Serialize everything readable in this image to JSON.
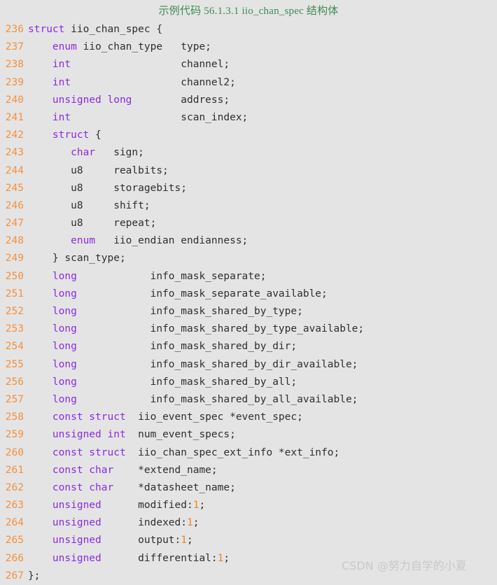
{
  "caption": "示例代码 56.1.3.1 iio_chan_spec 结构体",
  "watermark": "CSDN @努力自学的小夏",
  "colors": {
    "background": "#e4e4e4",
    "caption": "#3e8c53",
    "line_number": "#f6903d",
    "keyword": "#8a2be2",
    "number_literal": "#f4821f",
    "plain_text": "#2f2f2f",
    "watermark": "#c9c9c9"
  },
  "code": {
    "language": "c",
    "first_line_number": 236,
    "last_line_number": 267,
    "lines": [
      {
        "number": "236",
        "text": "struct iio_chan_spec {",
        "tokens": [
          {
            "t": "struct",
            "k": "kw"
          },
          {
            "t": " iio_chan_spec {",
            "k": "pln"
          }
        ]
      },
      {
        "number": "237",
        "text": "    enum iio_chan_type   type;",
        "tokens": [
          {
            "t": "    ",
            "k": "pln"
          },
          {
            "t": "enum",
            "k": "kw"
          },
          {
            "t": " iio_chan_type   type;",
            "k": "pln"
          }
        ]
      },
      {
        "number": "238",
        "text": "    int                  channel;",
        "tokens": [
          {
            "t": "    ",
            "k": "pln"
          },
          {
            "t": "int",
            "k": "kw"
          },
          {
            "t": "                  channel;",
            "k": "pln"
          }
        ]
      },
      {
        "number": "239",
        "text": "    int                  channel2;",
        "tokens": [
          {
            "t": "    ",
            "k": "pln"
          },
          {
            "t": "int",
            "k": "kw"
          },
          {
            "t": "                  channel2;",
            "k": "pln"
          }
        ]
      },
      {
        "number": "240",
        "text": "    unsigned long        address;",
        "tokens": [
          {
            "t": "    ",
            "k": "pln"
          },
          {
            "t": "unsigned long",
            "k": "kw"
          },
          {
            "t": "        address;",
            "k": "pln"
          }
        ]
      },
      {
        "number": "241",
        "text": "    int                  scan_index;",
        "tokens": [
          {
            "t": "    ",
            "k": "pln"
          },
          {
            "t": "int",
            "k": "kw"
          },
          {
            "t": "                  scan_index;",
            "k": "pln"
          }
        ]
      },
      {
        "number": "242",
        "text": "    struct {",
        "tokens": [
          {
            "t": "    ",
            "k": "pln"
          },
          {
            "t": "struct",
            "k": "kw"
          },
          {
            "t": " {",
            "k": "pln"
          }
        ]
      },
      {
        "number": "243",
        "text": "       char   sign;",
        "tokens": [
          {
            "t": "       ",
            "k": "pln"
          },
          {
            "t": "char",
            "k": "kw"
          },
          {
            "t": "   sign;",
            "k": "pln"
          }
        ]
      },
      {
        "number": "244",
        "text": "       u8     realbits;",
        "tokens": [
          {
            "t": "       u8     realbits;",
            "k": "pln"
          }
        ]
      },
      {
        "number": "245",
        "text": "       u8     storagebits;",
        "tokens": [
          {
            "t": "       u8     storagebits;",
            "k": "pln"
          }
        ]
      },
      {
        "number": "246",
        "text": "       u8     shift;",
        "tokens": [
          {
            "t": "       u8     shift;",
            "k": "pln"
          }
        ]
      },
      {
        "number": "247",
        "text": "       u8     repeat;",
        "tokens": [
          {
            "t": "       u8     repeat;",
            "k": "pln"
          }
        ]
      },
      {
        "number": "248",
        "text": "       enum   iio_endian endianness;",
        "tokens": [
          {
            "t": "       ",
            "k": "pln"
          },
          {
            "t": "enum",
            "k": "kw"
          },
          {
            "t": "   iio_endian endianness;",
            "k": "pln"
          }
        ]
      },
      {
        "number": "249",
        "text": "    } scan_type;",
        "tokens": [
          {
            "t": "    } scan_type;",
            "k": "pln"
          }
        ]
      },
      {
        "number": "250",
        "text": "    long            info_mask_separate;",
        "tokens": [
          {
            "t": "    ",
            "k": "pln"
          },
          {
            "t": "long",
            "k": "kw"
          },
          {
            "t": "            info_mask_separate;",
            "k": "pln"
          }
        ]
      },
      {
        "number": "251",
        "text": "    long            info_mask_separate_available;",
        "tokens": [
          {
            "t": "    ",
            "k": "pln"
          },
          {
            "t": "long",
            "k": "kw"
          },
          {
            "t": "            info_mask_separate_available;",
            "k": "pln"
          }
        ]
      },
      {
        "number": "252",
        "text": "    long            info_mask_shared_by_type;",
        "tokens": [
          {
            "t": "    ",
            "k": "pln"
          },
          {
            "t": "long",
            "k": "kw"
          },
          {
            "t": "            info_mask_shared_by_type;",
            "k": "pln"
          }
        ]
      },
      {
        "number": "253",
        "text": "    long            info_mask_shared_by_type_available;",
        "tokens": [
          {
            "t": "    ",
            "k": "pln"
          },
          {
            "t": "long",
            "k": "kw"
          },
          {
            "t": "            info_mask_shared_by_type_available;",
            "k": "pln"
          }
        ]
      },
      {
        "number": "254",
        "text": "    long            info_mask_shared_by_dir;",
        "tokens": [
          {
            "t": "    ",
            "k": "pln"
          },
          {
            "t": "long",
            "k": "kw"
          },
          {
            "t": "            info_mask_shared_by_dir;",
            "k": "pln"
          }
        ]
      },
      {
        "number": "255",
        "text": "    long            info_mask_shared_by_dir_available;",
        "tokens": [
          {
            "t": "    ",
            "k": "pln"
          },
          {
            "t": "long",
            "k": "kw"
          },
          {
            "t": "            info_mask_shared_by_dir_available;",
            "k": "pln"
          }
        ]
      },
      {
        "number": "256",
        "text": "    long            info_mask_shared_by_all;",
        "tokens": [
          {
            "t": "    ",
            "k": "pln"
          },
          {
            "t": "long",
            "k": "kw"
          },
          {
            "t": "            info_mask_shared_by_all;",
            "k": "pln"
          }
        ]
      },
      {
        "number": "257",
        "text": "    long            info_mask_shared_by_all_available;",
        "tokens": [
          {
            "t": "    ",
            "k": "pln"
          },
          {
            "t": "long",
            "k": "kw"
          },
          {
            "t": "            info_mask_shared_by_all_available;",
            "k": "pln"
          }
        ]
      },
      {
        "number": "258",
        "text": "    const struct  iio_event_spec *event_spec;",
        "tokens": [
          {
            "t": "    ",
            "k": "pln"
          },
          {
            "t": "const struct",
            "k": "kw"
          },
          {
            "t": "  iio_event_spec *event_spec;",
            "k": "pln"
          }
        ]
      },
      {
        "number": "259",
        "text": "    unsigned int  num_event_specs;",
        "tokens": [
          {
            "t": "    ",
            "k": "pln"
          },
          {
            "t": "unsigned int",
            "k": "kw"
          },
          {
            "t": "  num_event_specs;",
            "k": "pln"
          }
        ]
      },
      {
        "number": "260",
        "text": "    const struct  iio_chan_spec_ext_info *ext_info;",
        "tokens": [
          {
            "t": "    ",
            "k": "pln"
          },
          {
            "t": "const struct",
            "k": "kw"
          },
          {
            "t": "  iio_chan_spec_ext_info *ext_info;",
            "k": "pln"
          }
        ]
      },
      {
        "number": "261",
        "text": "    const char    *extend_name;",
        "tokens": [
          {
            "t": "    ",
            "k": "pln"
          },
          {
            "t": "const char",
            "k": "kw"
          },
          {
            "t": "    *extend_name;",
            "k": "pln"
          }
        ]
      },
      {
        "number": "262",
        "text": "    const char    *datasheet_name;",
        "tokens": [
          {
            "t": "    ",
            "k": "pln"
          },
          {
            "t": "const char",
            "k": "kw"
          },
          {
            "t": "    *datasheet_name;",
            "k": "pln"
          }
        ]
      },
      {
        "number": "263",
        "text": "    unsigned      modified:1;",
        "tokens": [
          {
            "t": "    ",
            "k": "pln"
          },
          {
            "t": "unsigned",
            "k": "kw"
          },
          {
            "t": "      modified:",
            "k": "pln"
          },
          {
            "t": "1",
            "k": "num"
          },
          {
            "t": ";",
            "k": "pln"
          }
        ]
      },
      {
        "number": "264",
        "text": "    unsigned      indexed:1;",
        "tokens": [
          {
            "t": "    ",
            "k": "pln"
          },
          {
            "t": "unsigned",
            "k": "kw"
          },
          {
            "t": "      indexed:",
            "k": "pln"
          },
          {
            "t": "1",
            "k": "num"
          },
          {
            "t": ";",
            "k": "pln"
          }
        ]
      },
      {
        "number": "265",
        "text": "    unsigned      output:1;",
        "tokens": [
          {
            "t": "    ",
            "k": "pln"
          },
          {
            "t": "unsigned",
            "k": "kw"
          },
          {
            "t": "      output:",
            "k": "pln"
          },
          {
            "t": "1",
            "k": "num"
          },
          {
            "t": ";",
            "k": "pln"
          }
        ]
      },
      {
        "number": "266",
        "text": "    unsigned      differential:1;",
        "tokens": [
          {
            "t": "    ",
            "k": "pln"
          },
          {
            "t": "unsigned",
            "k": "kw"
          },
          {
            "t": "      differential:",
            "k": "pln"
          },
          {
            "t": "1",
            "k": "num"
          },
          {
            "t": ";",
            "k": "pln"
          }
        ]
      },
      {
        "number": "267",
        "text": "};",
        "tokens": [
          {
            "t": "};",
            "k": "pln"
          }
        ]
      }
    ]
  }
}
